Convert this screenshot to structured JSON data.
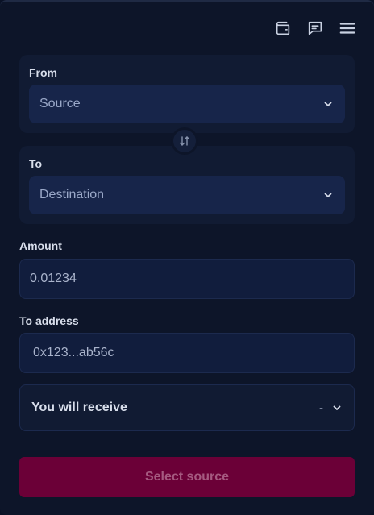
{
  "header": {
    "icons": [
      "wallet-icon",
      "chat-icon",
      "menu-icon"
    ]
  },
  "from": {
    "label": "From",
    "select_value": "Source"
  },
  "to": {
    "label": "To",
    "select_value": "Destination"
  },
  "amount": {
    "label": "Amount",
    "value": "0.01234"
  },
  "to_address": {
    "label": "To address",
    "value": "0x123...ab56c"
  },
  "receive": {
    "label": "You will receive",
    "value": "-"
  },
  "cta": {
    "label": "Select source"
  },
  "colors": {
    "background": "#0d1529",
    "panel": "#111b33",
    "select": "#17254a",
    "cta": "#6b0037",
    "cta_text": "#a55a80"
  }
}
